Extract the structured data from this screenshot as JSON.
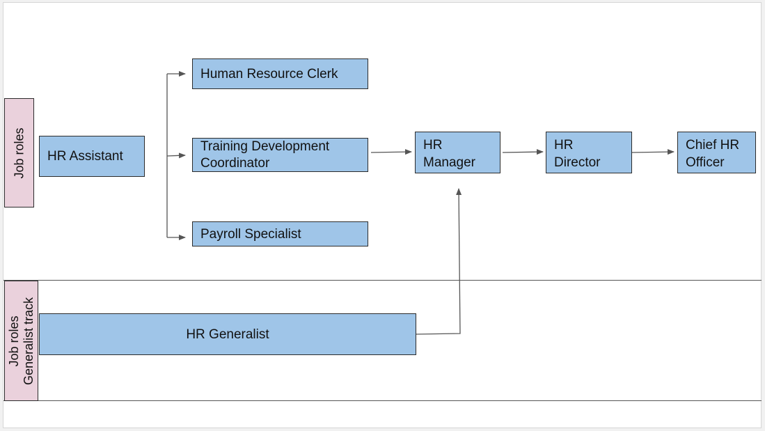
{
  "lanes": [
    {
      "id": "job-roles",
      "label": "Job roles"
    },
    {
      "id": "generalist-track",
      "label_line1": "Job roles",
      "label_line2": "Generalist track"
    }
  ],
  "nodes": {
    "hr_assistant": "HR Assistant",
    "hr_clerk": "Human Resource Clerk",
    "training_line1": "Training Development",
    "training_line2": "Coordinator",
    "payroll": "Payroll Specialist",
    "hr_manager_line1": "HR",
    "hr_manager_line2": "Manager",
    "hr_director_line1": "HR",
    "hr_director_line2": "Director",
    "cho_line1": "Chief HR",
    "cho_line2": "Officer",
    "hr_generalist": "HR Generalist"
  },
  "edges": [
    {
      "from": "HR Assistant",
      "to": "Human Resource Clerk"
    },
    {
      "from": "HR Assistant",
      "to": "Training Development Coordinator"
    },
    {
      "from": "HR Assistant",
      "to": "Payroll Specialist"
    },
    {
      "from": "Training Development Coordinator",
      "to": "HR Manager"
    },
    {
      "from": "HR Manager",
      "to": "HR Director"
    },
    {
      "from": "HR Director",
      "to": "Chief HR Officer"
    },
    {
      "from": "HR Generalist",
      "to": "HR Manager"
    }
  ],
  "colors": {
    "node_fill": "#9fc5e8",
    "lane_label_fill": "#ead1dc",
    "connector": "#555555"
  }
}
